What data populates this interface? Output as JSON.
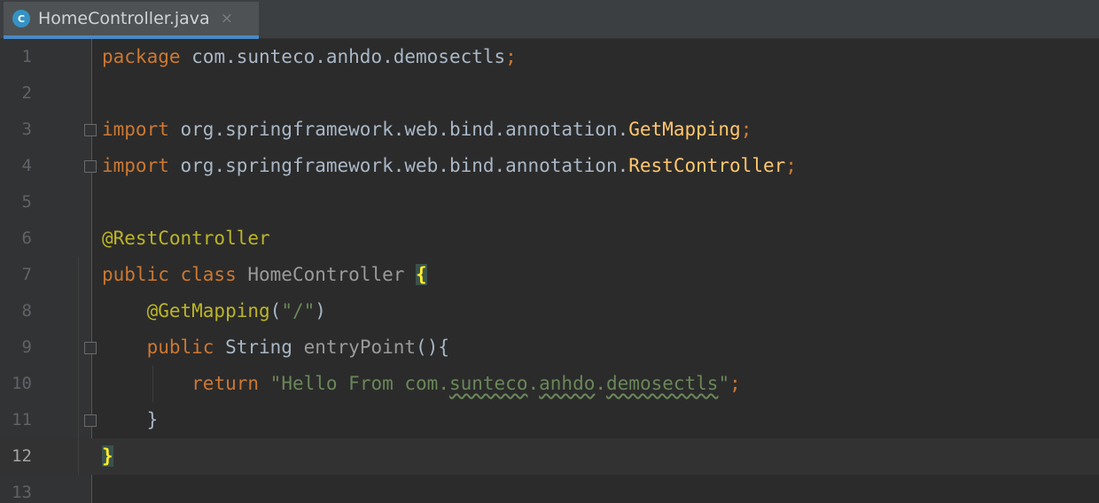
{
  "tab": {
    "title": "HomeController.java",
    "icon": "java-class-icon",
    "icon_letter": "C",
    "close": "×"
  },
  "editor": {
    "current_line": 12,
    "lines": [
      {
        "num": "1",
        "tokens": [
          {
            "t": "package ",
            "c": "kw"
          },
          {
            "t": "com.sunteco.anhdo.demosectls",
            "c": "gray"
          },
          {
            "t": ";",
            "c": "kw"
          }
        ]
      },
      {
        "num": "2",
        "tokens": []
      },
      {
        "num": "3",
        "tokens": [
          {
            "t": "import ",
            "c": "kw"
          },
          {
            "t": "org.springframework.web.bind.annotation.",
            "c": "gray"
          },
          {
            "t": "GetMapping",
            "c": "cls"
          },
          {
            "t": ";",
            "c": "kw"
          }
        ]
      },
      {
        "num": "4",
        "tokens": [
          {
            "t": "import ",
            "c": "kw"
          },
          {
            "t": "org.springframework.web.bind.annotation.",
            "c": "gray"
          },
          {
            "t": "RestController",
            "c": "cls"
          },
          {
            "t": ";",
            "c": "kw"
          }
        ]
      },
      {
        "num": "5",
        "tokens": []
      },
      {
        "num": "6",
        "tokens": [
          {
            "t": "@RestController",
            "c": "ann"
          }
        ]
      },
      {
        "num": "7",
        "tokens": [
          {
            "t": "public class ",
            "c": "kw"
          },
          {
            "t": "HomeController ",
            "c": "dim"
          },
          {
            "t": "{",
            "c": "brace-hl"
          }
        ]
      },
      {
        "num": "8",
        "tokens": [
          {
            "t": "    ",
            "c": "gray"
          },
          {
            "t": "@GetMapping",
            "c": "ann"
          },
          {
            "t": "(",
            "c": "gray"
          },
          {
            "t": "\"/\"",
            "c": "str"
          },
          {
            "t": ")",
            "c": "gray"
          }
        ]
      },
      {
        "num": "9",
        "tokens": [
          {
            "t": "    ",
            "c": "gray"
          },
          {
            "t": "public ",
            "c": "kw"
          },
          {
            "t": "String ",
            "c": "gray"
          },
          {
            "t": "entryPoint",
            "c": "dim"
          },
          {
            "t": "(){",
            "c": "gray"
          }
        ]
      },
      {
        "num": "10",
        "tokens": [
          {
            "t": "        ",
            "c": "gray"
          },
          {
            "t": "return ",
            "c": "kw"
          },
          {
            "t": "\"Hello From com.",
            "c": "str"
          },
          {
            "t": "sunteco",
            "c": "str squig"
          },
          {
            "t": ".",
            "c": "str"
          },
          {
            "t": "anhdo",
            "c": "str squig"
          },
          {
            "t": ".",
            "c": "str"
          },
          {
            "t": "demosectls",
            "c": "str squig"
          },
          {
            "t": "\"",
            "c": "str"
          },
          {
            "t": ";",
            "c": "kw"
          }
        ]
      },
      {
        "num": "11",
        "tokens": [
          {
            "t": "    }",
            "c": "gray"
          }
        ]
      },
      {
        "num": "12",
        "tokens": [
          {
            "t": "}",
            "c": "brace-hl"
          }
        ]
      },
      {
        "num": "13",
        "tokens": []
      }
    ]
  }
}
